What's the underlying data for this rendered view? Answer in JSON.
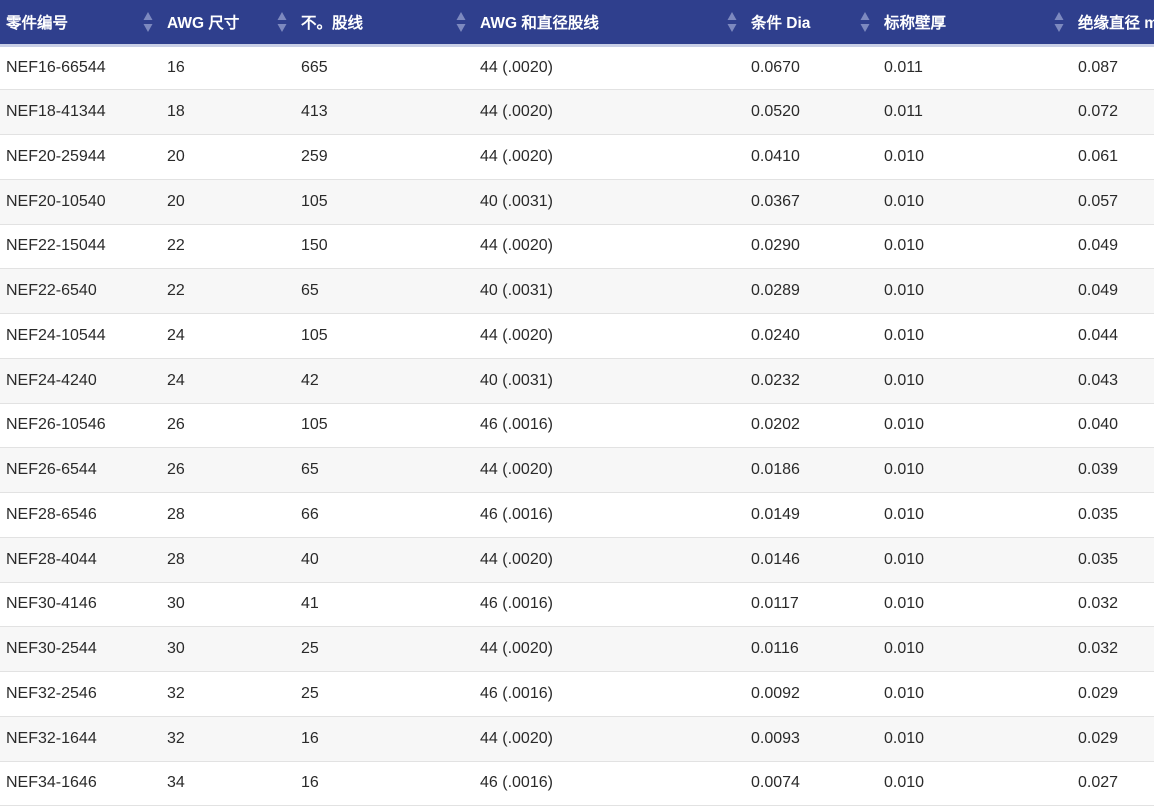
{
  "table": {
    "headers": [
      "零件编号",
      "AWG 尺寸",
      "不。股线",
      "AWG 和直径股线",
      "条件 Dia",
      "标称壁厚",
      "绝缘直径 m"
    ],
    "sort_icon": "sort-updown-icon",
    "colors": {
      "header_bg": "#2f3f8d",
      "header_text": "#ffffff",
      "row_alt": "#f7f7f7",
      "row": "#ffffff"
    },
    "rows": [
      [
        "NEF16-66544",
        "16",
        "665",
        "44 (.0020)",
        "0.0670",
        "0.011",
        "0.087"
      ],
      [
        "NEF18-41344",
        "18",
        "413",
        "44 (.0020)",
        "0.0520",
        "0.011",
        "0.072"
      ],
      [
        "NEF20-25944",
        "20",
        "259",
        "44 (.0020)",
        "0.0410",
        "0.010",
        "0.061"
      ],
      [
        "NEF20-10540",
        "20",
        "105",
        "40 (.0031)",
        "0.0367",
        "0.010",
        "0.057"
      ],
      [
        "NEF22-15044",
        "22",
        "150",
        "44 (.0020)",
        "0.0290",
        "0.010",
        "0.049"
      ],
      [
        "NEF22-6540",
        "22",
        "65",
        "40 (.0031)",
        "0.0289",
        "0.010",
        "0.049"
      ],
      [
        "NEF24-10544",
        "24",
        "105",
        "44 (.0020)",
        "0.0240",
        "0.010",
        "0.044"
      ],
      [
        "NEF24-4240",
        "24",
        "42",
        "40 (.0031)",
        "0.0232",
        "0.010",
        "0.043"
      ],
      [
        "NEF26-10546",
        "26",
        "105",
        "46 (.0016)",
        "0.0202",
        "0.010",
        "0.040"
      ],
      [
        "NEF26-6544",
        "26",
        "65",
        "44 (.0020)",
        "0.0186",
        "0.010",
        "0.039"
      ],
      [
        "NEF28-6546",
        "28",
        "66",
        "46 (.0016)",
        "0.0149",
        "0.010",
        "0.035"
      ],
      [
        "NEF28-4044",
        "28",
        "40",
        "44 (.0020)",
        "0.0146",
        "0.010",
        "0.035"
      ],
      [
        "NEF30-4146",
        "30",
        "41",
        "46 (.0016)",
        "0.0117",
        "0.010",
        "0.032"
      ],
      [
        "NEF30-2544",
        "30",
        "25",
        "44 (.0020)",
        "0.0116",
        "0.010",
        "0.032"
      ],
      [
        "NEF32-2546",
        "32",
        "25",
        "46 (.0016)",
        "0.0092",
        "0.010",
        "0.029"
      ],
      [
        "NEF32-1644",
        "32",
        "16",
        "44 (.0020)",
        "0.0093",
        "0.010",
        "0.029"
      ],
      [
        "NEF34-1646",
        "34",
        "16",
        "46 (.0016)",
        "0.0074",
        "0.010",
        "0.027"
      ]
    ]
  }
}
